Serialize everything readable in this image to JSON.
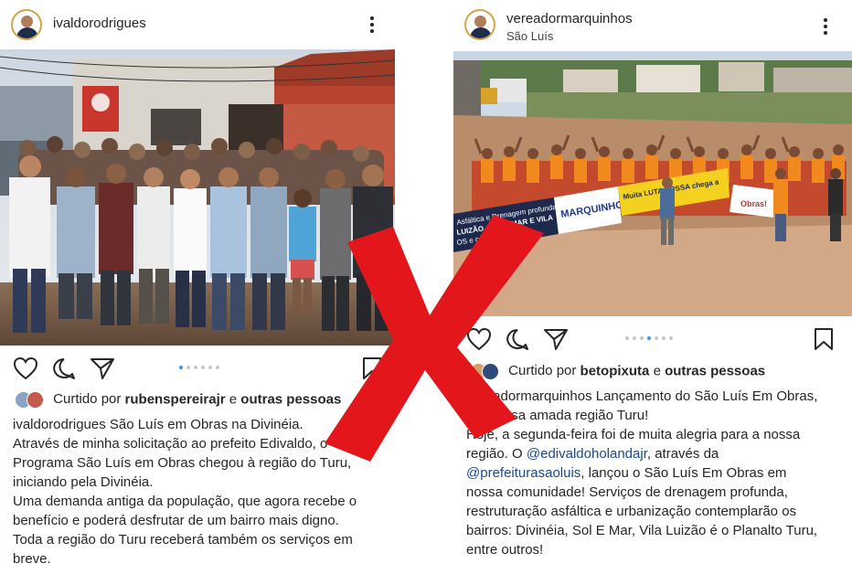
{
  "left_post": {
    "username": "ivaldorodrigues",
    "carousel_dots": 6,
    "carousel_active": 0,
    "liked_by_prefix": "Curtido por",
    "liked_by_user": "rubenspereirajr",
    "liked_by_conj": "e",
    "liked_by_others": "outras pessoas",
    "caption_username": "ivaldorodrigues",
    "caption_lines": [
      "São Luís em Obras na Divinéia.",
      "Através de minha solicitação ao prefeito Edivaldo, o",
      "Programa São Luís em Obras chegou à região do Turu,",
      "iniciando pela Divinéia.",
      "Uma demanda antiga da população, que agora recebe o",
      "benefício e poderá desfrutar de um bairro mais digno.",
      "Toda a região do Turu receberá também os serviços em",
      "breve."
    ]
  },
  "right_post": {
    "username": "vereadormarquinhos",
    "location": "São Luís",
    "carousel_dots": 7,
    "carousel_active": 3,
    "liked_by_prefix": "Curtido por",
    "liked_by_user": "betopixuta",
    "liked_by_conj": "e",
    "liked_by_others": "outras pessoas",
    "caption_username": "vereadormarquinhos",
    "caption_first": "Lançamento do São Luís Em Obras,",
    "caption_l2": "em nossa amada região Turu!",
    "caption_l3": "Hoje, a segunda-feira foi de muita alegria para a nossa",
    "caption_l4_pre": "região. O",
    "caption_l4_mention": "@edivaldoholandajr",
    "caption_l4_post": ", através da",
    "caption_l5_mention": "@prefeiturasaoluis",
    "caption_l5_post": ", lançou o São Luís Em Obras em",
    "caption_l6": "nossa comunidade! Serviços de drenagem profunda,",
    "caption_l7": "restruturação asfáltica e urbanização contemplarão os",
    "caption_l8": "bairros: Divinéia, Sol E Mar, Vila Luizão é o Planalto Turu,",
    "caption_l9": "entre outros!",
    "banner_text_1": "Asfáltica e Drenagem profunda",
    "banner_text_2": "LUIZÃO, SOL E MAR E VILA",
    "banner_text_3": "OS e comunitários",
    "banner_brand": "MARQUINHOS",
    "banner_yellow": "Muita LUTA NOSSA chega a",
    "banner_white": "Obras!"
  },
  "overlay": {
    "mark": "X",
    "color": "#e3161b"
  },
  "colors": {
    "link": "#1a4b8a",
    "dot_active": "#3897f0",
    "text": "#262626"
  }
}
